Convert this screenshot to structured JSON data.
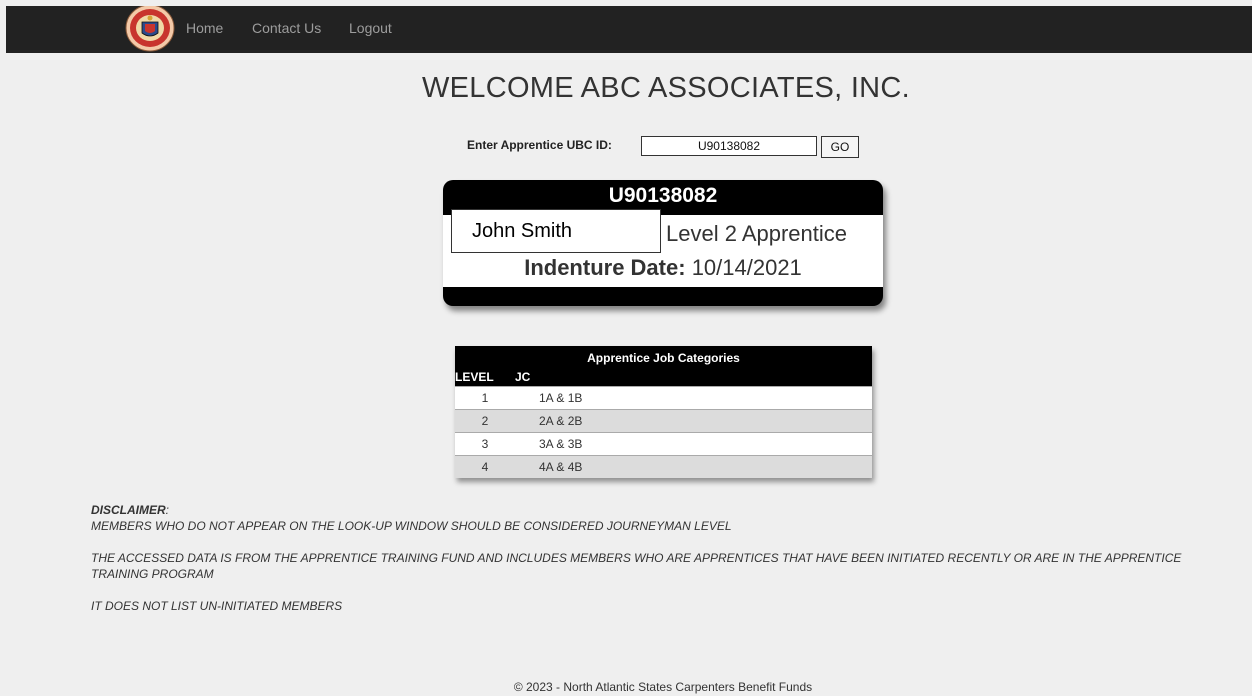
{
  "nav": {
    "logo_icon": "ubc-union-seal-logo",
    "links": [
      "Home",
      "Contact Us",
      "Logout"
    ]
  },
  "welcome": "WELCOME ABC ASSOCIATES, INC.",
  "search": {
    "label": "Enter Apprentice UBC ID:",
    "value": "U90138082",
    "button": "GO"
  },
  "card": {
    "id": "U90138082",
    "name": "John Smith",
    "level": "Level 2 Apprentice",
    "indenture_label": "Indenture Date:",
    "indenture_date": "10/14/2021"
  },
  "job_categories": {
    "title": "Apprentice Job Categories",
    "headers": [
      "LEVEL",
      "JC"
    ],
    "rows": [
      {
        "level": "1",
        "jc": "1A & 1B"
      },
      {
        "level": "2",
        "jc": "2A & 2B"
      },
      {
        "level": "3",
        "jc": "3A & 3B"
      },
      {
        "level": "4",
        "jc": "4A & 4B"
      }
    ]
  },
  "disclaimer": {
    "title": "DISCLAIMER",
    "lines": [
      "MEMBERS WHO DO NOT APPEAR ON THE LOOK-UP WINDOW SHOULD BE CONSIDERED JOURNEYMAN LEVEL",
      "THE ACCESSED DATA IS FROM THE APPRENTICE TRAINING FUND AND INCLUDES MEMBERS WHO ARE APPRENTICES THAT HAVE BEEN INITIATED RECENTLY OR ARE IN THE APPRENTICE TRAINING PROGRAM",
      "IT DOES NOT LIST UN-INITIATED MEMBERS"
    ]
  },
  "footer": "© 2023 - North Atlantic States Carpenters Benefit Funds"
}
